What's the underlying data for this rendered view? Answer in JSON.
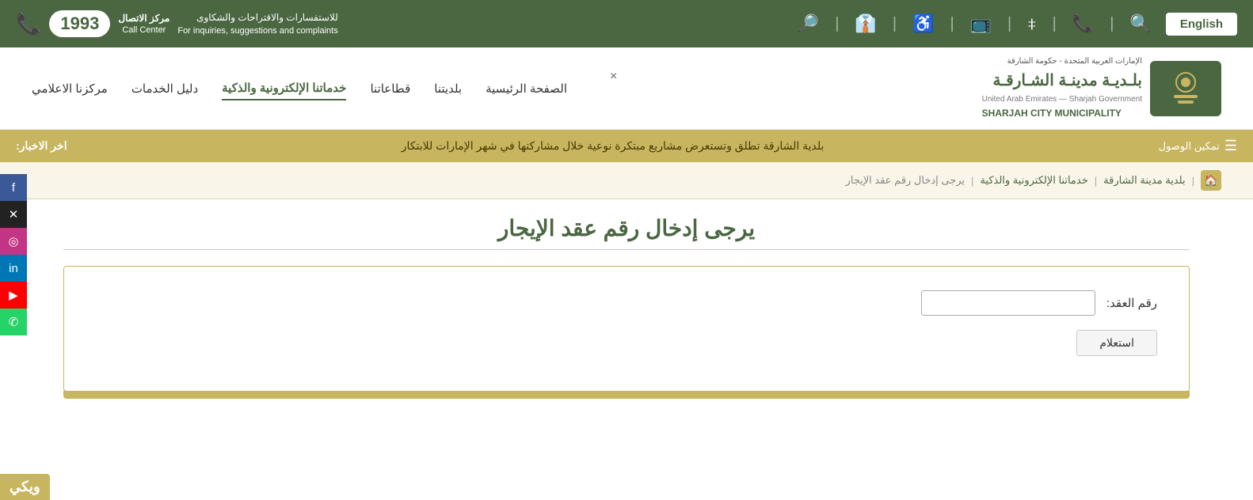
{
  "topbar": {
    "english_label": "English",
    "call_center_label": "مركز الاتصال\nCall Center",
    "call_center_number": "1993",
    "call_center_desc": "للاستفسارات والاقتراحات والشكاوى\nFor inquiries, suggestions and complaints"
  },
  "nav": {
    "items": [
      {
        "label": "الصفحة الرئيسية",
        "active": false
      },
      {
        "label": "بلديتنا",
        "active": false
      },
      {
        "label": "قطاعاتنا",
        "active": false
      },
      {
        "label": "خدماتنا الإلكترونية والذكية",
        "active": true
      },
      {
        "label": "دليل الخدمات",
        "active": false
      },
      {
        "label": "مركزنا الاعلامي",
        "active": false
      }
    ]
  },
  "news": {
    "label": "اخر الاخبار:",
    "text": "بلدية الشارقة تطلق وتستعرض مشاريع مبتكرة نوعية خلال مشاركتها في شهر الإمارات للابتكار",
    "accessibility_label": "تمكين الوصول"
  },
  "breadcrumb": {
    "home_icon": "🏠",
    "items": [
      {
        "label": "بلدية مدينة الشارقة",
        "link": true
      },
      {
        "label": "خدماتنا الإلكترونية والذكية",
        "link": true
      },
      {
        "label": "يرجى إدخال رقم عقد الإيجار",
        "link": false
      }
    ]
  },
  "page": {
    "title": "يرجى إدخال رقم عقد الإيجار",
    "form": {
      "contract_number_label": "رقم العقد:",
      "contract_number_placeholder": "",
      "submit_label": "استعلام"
    }
  },
  "social": {
    "items": [
      {
        "name": "facebook",
        "symbol": "f"
      },
      {
        "name": "x-twitter",
        "symbol": "𝕏"
      },
      {
        "name": "instagram",
        "symbol": "📷"
      },
      {
        "name": "linkedin",
        "symbol": "in"
      },
      {
        "name": "youtube",
        "symbol": "▶"
      },
      {
        "name": "whatsapp",
        "symbol": "✆"
      }
    ]
  },
  "wiki": {
    "label": "ويكي"
  },
  "close_btn": "×"
}
